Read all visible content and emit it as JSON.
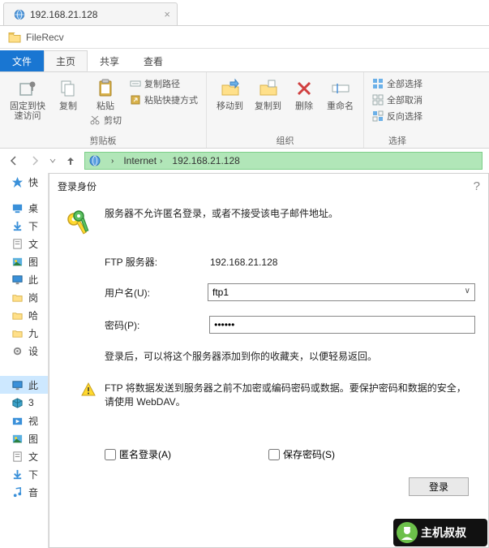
{
  "browser_tab": {
    "title": "192.168.21.128",
    "close": "×"
  },
  "location": {
    "folder_name": "FileRecv"
  },
  "ribbon": {
    "tabs": {
      "file": "文件",
      "home": "主页",
      "share": "共享",
      "view": "查看"
    },
    "pin": {
      "label": "固定到快\n速访问"
    },
    "copy": {
      "label": "复制"
    },
    "paste": {
      "label": "粘贴"
    },
    "cut": {
      "label": "剪切"
    },
    "copy_path": {
      "label": "复制路径"
    },
    "paste_shortcut": {
      "label": "粘贴快捷方式"
    },
    "group_clipboard": "剪贴板",
    "move_to": {
      "label": "移动到"
    },
    "copy_to": {
      "label": "复制到"
    },
    "delete": {
      "label": "删除"
    },
    "rename": {
      "label": "重命名"
    },
    "group_organize": "组织",
    "select_all": {
      "label": "全部选择"
    },
    "select_none": {
      "label": "全部取消"
    },
    "invert": {
      "label": "反向选择"
    },
    "group_select": "选择"
  },
  "breadcrumb": {
    "internet": "Internet",
    "ip": "192.168.21.128"
  },
  "sidebar": {
    "items": [
      {
        "label": "快",
        "kind": "quick"
      },
      {
        "label": "桌",
        "kind": "desktop"
      },
      {
        "label": "下",
        "kind": "download"
      },
      {
        "label": "文",
        "kind": "doc"
      },
      {
        "label": "图",
        "kind": "pic"
      },
      {
        "label": "此",
        "kind": "pc"
      },
      {
        "label": "岗",
        "kind": "folder"
      },
      {
        "label": "哈",
        "kind": "folder"
      },
      {
        "label": "九",
        "kind": "folder"
      },
      {
        "label": "设",
        "kind": "gear"
      },
      {
        "label": "此",
        "kind": "monitor",
        "sel": true
      },
      {
        "label": "3",
        "kind": "cube"
      },
      {
        "label": "视",
        "kind": "video"
      },
      {
        "label": "图",
        "kind": "pic"
      },
      {
        "label": "文",
        "kind": "doc"
      },
      {
        "label": "下",
        "kind": "download"
      },
      {
        "label": "音",
        "kind": "music"
      }
    ]
  },
  "dialog": {
    "title": "登录身份",
    "message": "服务器不允许匿名登录，或者不接受该电子邮件地址。",
    "server_label": "FTP 服务器:",
    "server_value": "192.168.21.128",
    "user_label": "用户名(U):",
    "user_value": "ftp1",
    "pass_label": "密码(P):",
    "pass_value": "••••••",
    "tip": "登录后，可以将这个服务器添加到你的收藏夹，以便轻易返回。",
    "warning": "FTP 将数据发送到服务器之前不加密或编码密码或数据。要保护密码和数据的安全，请使用 WebDAV。",
    "anon_label": "匿名登录(A)",
    "save_label": "保存密码(S)",
    "login_btn": "登录"
  },
  "watermark": {
    "text": "主机叔叔"
  }
}
